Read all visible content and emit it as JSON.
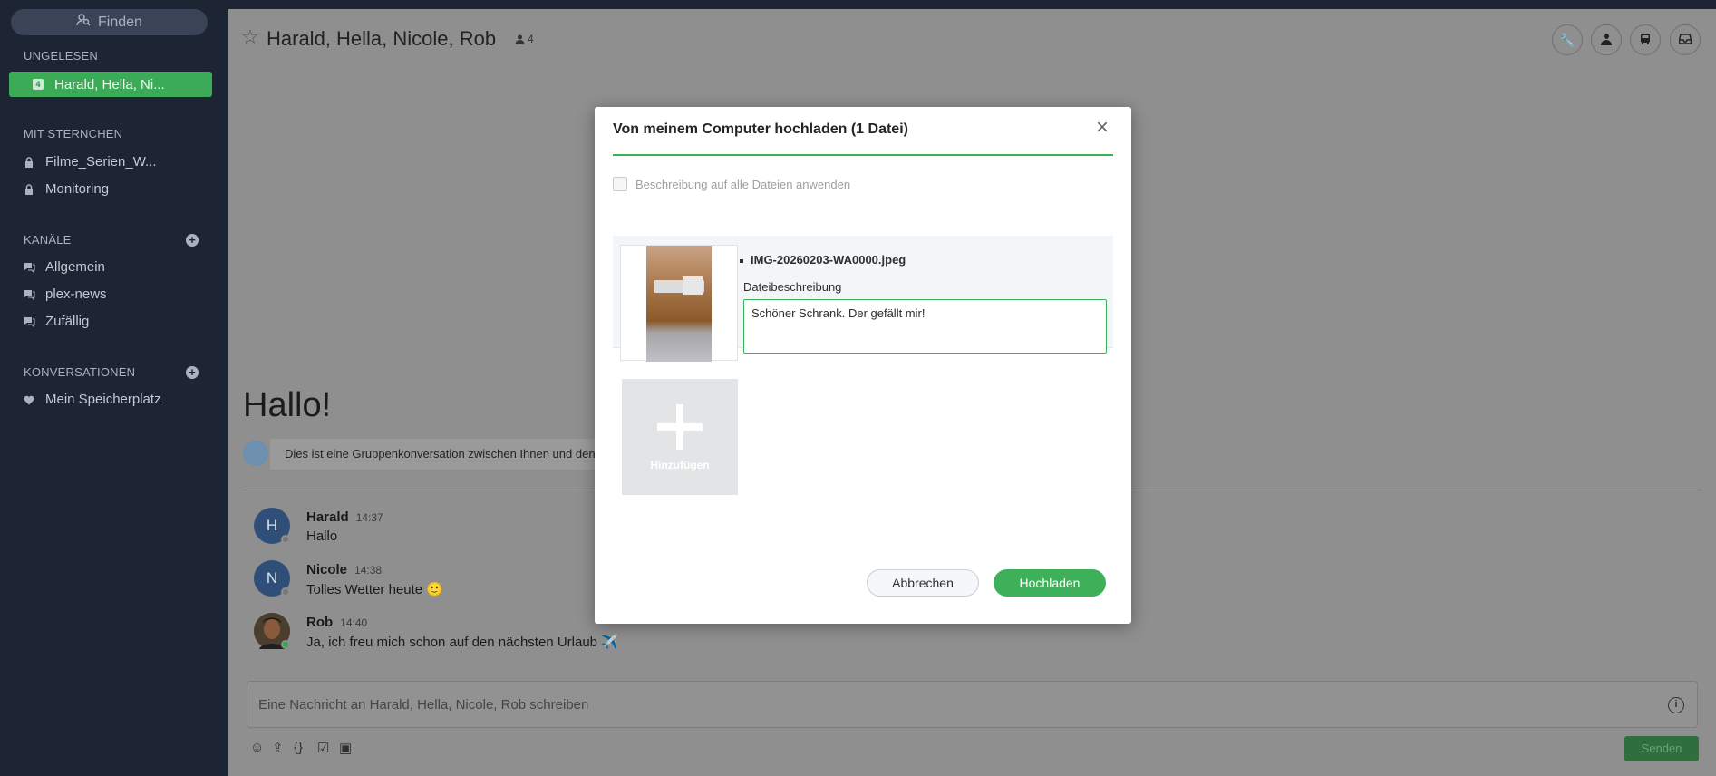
{
  "sidebar": {
    "search_label": "Finden",
    "sections": {
      "unread": "UNGELESEN",
      "starred": "MIT STERNCHEN",
      "channels": "KANÄLE",
      "conversations": "KONVERSATIONEN"
    },
    "unread_items": [
      {
        "label": "Harald, Hella, Ni...",
        "badge": "4"
      }
    ],
    "starred_items": [
      {
        "label": "Filme_Serien_W..."
      },
      {
        "label": "Monitoring"
      }
    ],
    "channel_items": [
      {
        "label": "Allgemein"
      },
      {
        "label": "plex-news"
      },
      {
        "label": "Zufällig"
      }
    ],
    "conversation_items": [
      {
        "label": "Mein Speicherplatz"
      }
    ]
  },
  "room": {
    "title": "Harald, Hella, Nicole, Rob",
    "member_count": "4",
    "greeting": "Hallo!",
    "intro": "Dies ist eine Gruppenkonversation zwischen Ihnen und den"
  },
  "messages": [
    {
      "initial": "H",
      "author": "Harald",
      "time": "14:37",
      "text": "Hallo"
    },
    {
      "initial": "N",
      "author": "Nicole",
      "time": "14:38",
      "text": "Tolles Wetter heute 🙂"
    },
    {
      "initial": "",
      "author": "Rob",
      "time": "14:40",
      "text": "Ja, ich freu mich schon auf den nächsten Urlaub ✈️"
    }
  ],
  "composer": {
    "placeholder": "Eine Nachricht an Harald, Hella, Nicole, Rob schreiben",
    "send_label": "Senden"
  },
  "modal": {
    "title": "Von meinem Computer hochladen (1 Datei)",
    "apply_all_label": "Beschreibung auf alle Dateien anwenden",
    "file_name": "IMG-20260203-WA0000.jpeg",
    "description_label": "Dateibeschreibung",
    "description_value": "Schöner Schrank. Der gefällt mir!",
    "add_label": "Hinzufügen",
    "cancel_label": "Abbrechen",
    "upload_label": "Hochladen"
  },
  "colors": {
    "accent": "#3fb05a",
    "sidebar_bg": "#1d2433"
  }
}
